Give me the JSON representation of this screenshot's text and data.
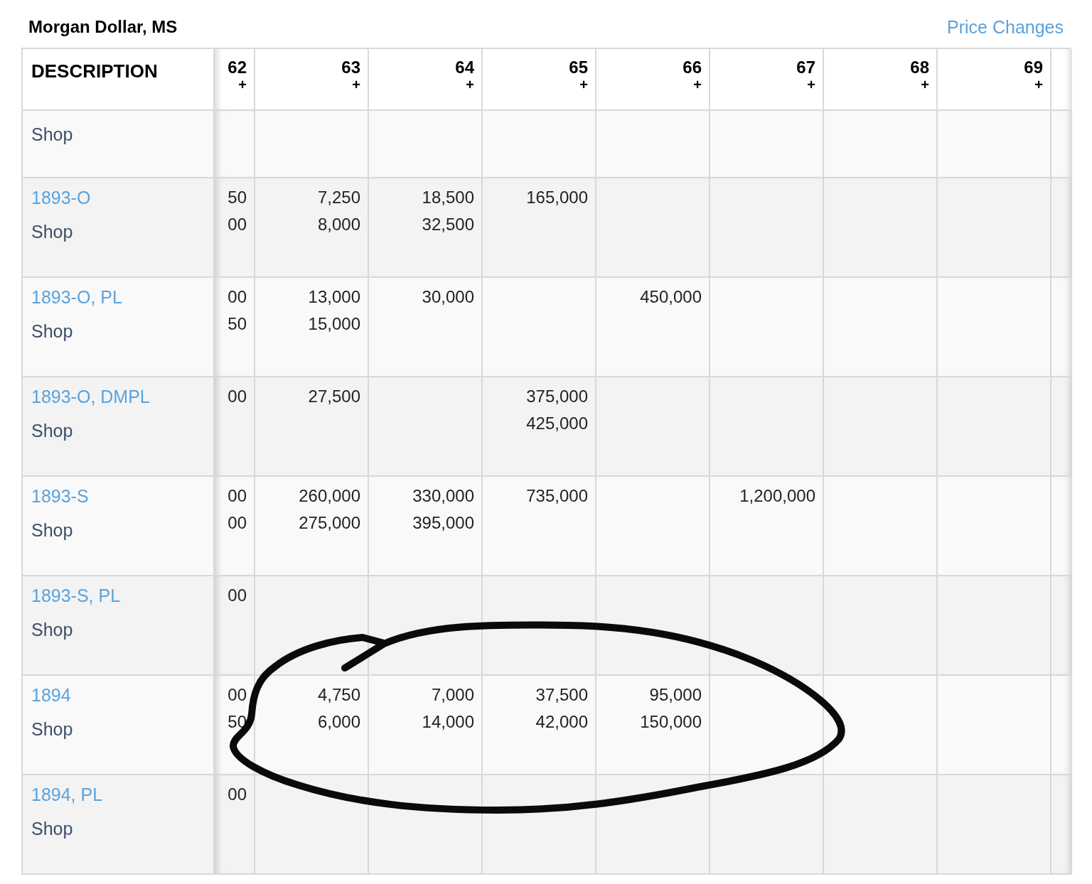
{
  "title": "Morgan Dollar, MS",
  "price_changes_link": "Price Changes",
  "columns": [
    {
      "label": "DESCRIPTION"
    },
    {
      "label": "62",
      "sub": "+"
    },
    {
      "label": "63",
      "sub": "+"
    },
    {
      "label": "64",
      "sub": "+"
    },
    {
      "label": "65",
      "sub": "+"
    },
    {
      "label": "66",
      "sub": "+"
    },
    {
      "label": "67",
      "sub": "+"
    },
    {
      "label": "68",
      "sub": "+"
    },
    {
      "label": "69",
      "sub": "+"
    }
  ],
  "rows": [
    {
      "shop": "Shop",
      "cells": [
        [],
        [],
        [],
        [],
        [],
        [],
        [],
        []
      ]
    },
    {
      "link": "1893-O",
      "shop": "Shop",
      "cells": [
        [
          "50",
          "00"
        ],
        [
          "7,250",
          "8,000"
        ],
        [
          "18,500",
          "32,500"
        ],
        [
          "165,000"
        ],
        [],
        [],
        [],
        []
      ]
    },
    {
      "link": "1893-O, PL",
      "shop": "Shop",
      "cells": [
        [
          "00",
          "50"
        ],
        [
          "13,000",
          "15,000"
        ],
        [
          "30,000"
        ],
        [],
        [
          "450,000"
        ],
        [],
        [],
        []
      ]
    },
    {
      "link": "1893-O, DMPL",
      "shop": "Shop",
      "cells": [
        [
          "00"
        ],
        [
          "27,500"
        ],
        [],
        [
          "375,000",
          "425,000"
        ],
        [],
        [],
        [],
        []
      ]
    },
    {
      "link": "1893-S",
      "shop": "Shop",
      "cells": [
        [
          "00",
          "00"
        ],
        [
          "260,000",
          "275,000"
        ],
        [
          "330,000",
          "395,000"
        ],
        [
          "735,000"
        ],
        [],
        [
          "1,200,000"
        ],
        [],
        []
      ]
    },
    {
      "link": "1893-S, PL",
      "shop": "Shop",
      "cells": [
        [
          "00"
        ],
        [],
        [],
        [],
        [],
        [],
        [],
        []
      ]
    },
    {
      "link": "1894",
      "shop": "Shop",
      "cells": [
        [
          "00",
          "50"
        ],
        [
          "4,750",
          "6,000"
        ],
        [
          "7,000",
          "14,000"
        ],
        [
          "37,500",
          "42,000"
        ],
        [
          "95,000",
          "150,000"
        ],
        [],
        [],
        []
      ]
    },
    {
      "link": "1894, PL",
      "shop": "Shop",
      "cells": [
        [
          "00"
        ],
        [],
        [],
        [],
        [],
        [],
        [],
        []
      ]
    }
  ]
}
